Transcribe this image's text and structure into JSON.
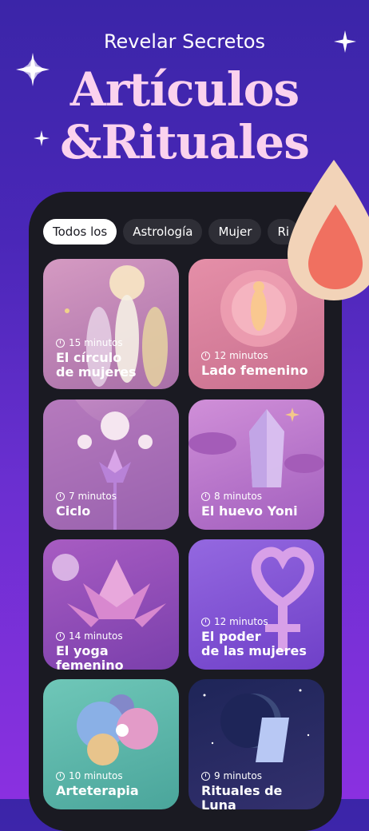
{
  "header": {
    "subtitle": "Revelar Secretos",
    "title_line1": "Artículos",
    "title_line2": "&Rituales"
  },
  "tabs": [
    {
      "label": "Todos los",
      "active": true
    },
    {
      "label": "Astrología",
      "active": false
    },
    {
      "label": "Mujer",
      "active": false
    },
    {
      "label": "Ri",
      "active": false
    }
  ],
  "cards": [
    {
      "minutes": "15 minutos",
      "title": "El círculo\nde mujeres",
      "color": "#c88fb8"
    },
    {
      "minutes": "12 minutos",
      "title": "Lado femenino",
      "color": "#d97a98"
    },
    {
      "minutes": "7 minutos",
      "title": "Ciclo",
      "color": "#b773b4"
    },
    {
      "minutes": "8 minutos",
      "title": "El huevo Yoni",
      "color": "#c27fcf"
    },
    {
      "minutes": "14 minutos",
      "title": "El yoga femenino",
      "color": "#9a50c0"
    },
    {
      "minutes": "12 minutos",
      "title": "El poder\nde las mujeres",
      "color": "#8453d8"
    },
    {
      "minutes": "10 minutos",
      "title": "Arteterapia",
      "color": "#5fb7a8"
    },
    {
      "minutes": "9 minutos",
      "title": "Rituales de Luna",
      "color": "#1f2a5a"
    }
  ],
  "icons": {
    "sparkle": "sparkle-icon",
    "clock": "clock-icon",
    "drop": "drop-icon"
  }
}
